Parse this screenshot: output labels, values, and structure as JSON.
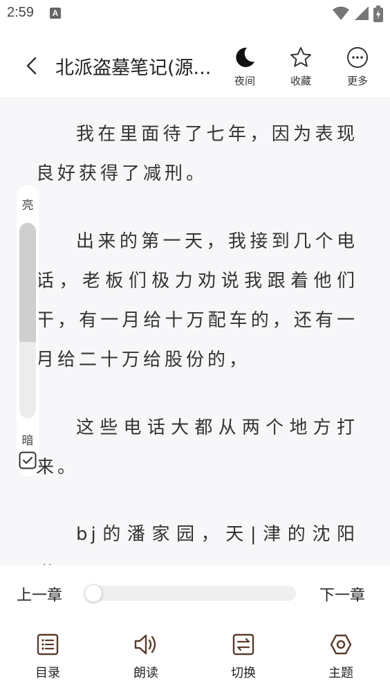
{
  "status_bar": {
    "time": "2:59",
    "notification_letter": "A",
    "icons": [
      "wifi-icon",
      "signal-icon",
      "battery-icon"
    ]
  },
  "header": {
    "title": "北派盗墓笔记(源...",
    "actions": [
      {
        "id": "night",
        "label": "夜间",
        "icon": "moon-icon"
      },
      {
        "id": "favorite",
        "label": "收藏",
        "icon": "star-icon"
      },
      {
        "id": "more",
        "label": "更多",
        "icon": "more-icon"
      }
    ]
  },
  "content": {
    "paragraphs": [
      "我在里面待了七年，因为表现良好获得了减刑。",
      "出来的第一天，我接到几个电话，老板们极力劝说我跟着他们干，有一月给十万配车的，还有一月给二十万给股份的，",
      "这些电话大都从两个地方打来。",
      "bj的潘家园，天|津的沈阳道。"
    ]
  },
  "brightness": {
    "bright_label": "亮",
    "dark_label": "暗",
    "level": 0.61,
    "follow_system_checked": true
  },
  "chapter_nav": {
    "prev_label": "上一章",
    "next_label": "下一章",
    "progress": 0.0
  },
  "bottom_tabs": [
    {
      "id": "catalog",
      "label": "目录",
      "icon": "list-icon"
    },
    {
      "id": "read_aloud",
      "label": "朗读",
      "icon": "speaker-icon"
    },
    {
      "id": "switch",
      "label": "切换",
      "icon": "switch-icon"
    },
    {
      "id": "theme",
      "label": "主题",
      "icon": "theme-icon"
    }
  ],
  "colors": {
    "accent": "#5a3a2a",
    "page_bg": "#f7f7f9"
  }
}
